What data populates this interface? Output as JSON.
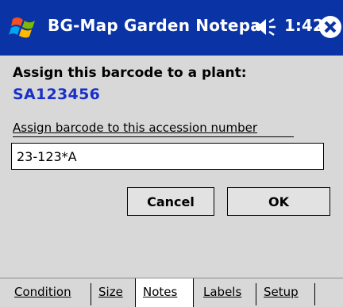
{
  "window": {
    "title": "BG-Map Garden Notepa",
    "clock": "1:42",
    "icons": {
      "start": "windows-flag-icon",
      "volume": "speaker-icon",
      "close": "close-icon"
    }
  },
  "main": {
    "assign_label": "Assign this barcode to a plant:",
    "barcode": "SA123456",
    "accession_label": "Assign barcode to this accession number",
    "accession_value": "23-123*A"
  },
  "buttons": {
    "cancel": "Cancel",
    "ok": "OK"
  },
  "tabs": [
    {
      "label": "Condition",
      "active": false
    },
    {
      "label": "Size",
      "active": false
    },
    {
      "label": "Notes",
      "active": true
    },
    {
      "label": "Labels",
      "active": false
    },
    {
      "label": "Setup",
      "active": false
    }
  ],
  "colors": {
    "titlebar": "#0a33a6",
    "barcode": "#1930c8",
    "background": "#d8d8d8"
  }
}
